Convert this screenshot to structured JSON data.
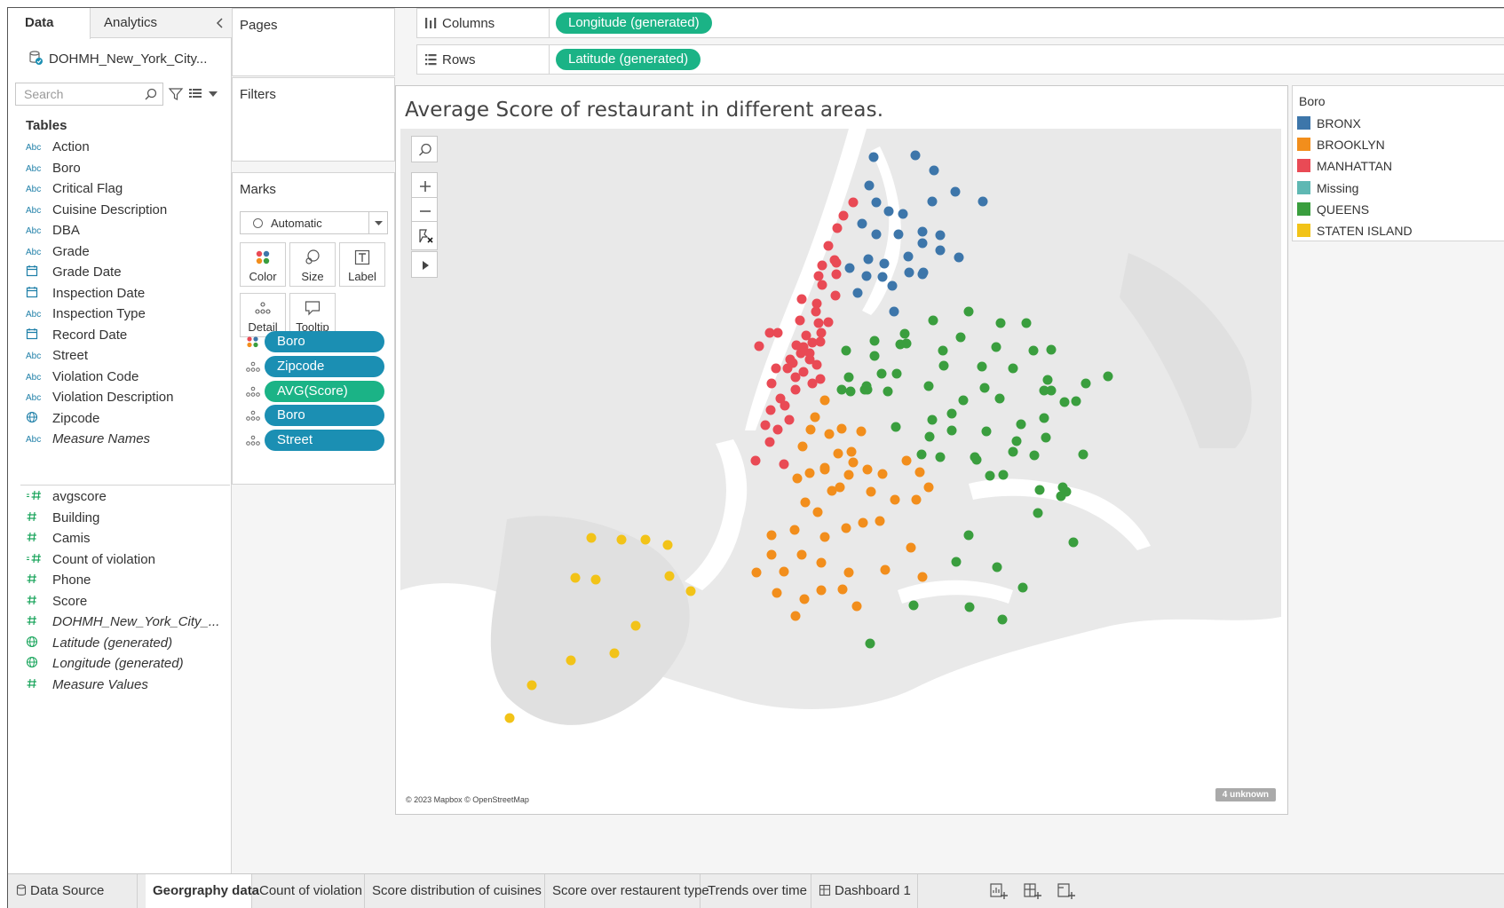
{
  "data_pane": {
    "tabs": {
      "data": "Data",
      "analytics": "Analytics"
    },
    "data_source": "DOHMH_New_York_City...",
    "search": {
      "placeholder": "Search"
    },
    "tables_title": "Tables",
    "dimensions": [
      {
        "type": "Abc",
        "name": "Action",
        "italic": false
      },
      {
        "type": "Abc",
        "name": "Boro",
        "italic": false
      },
      {
        "type": "Abc",
        "name": "Critical Flag",
        "italic": false
      },
      {
        "type": "Abc",
        "name": "Cuisine Description",
        "italic": false
      },
      {
        "type": "Abc",
        "name": "DBA",
        "italic": false
      },
      {
        "type": "Abc",
        "name": "Grade",
        "italic": false
      },
      {
        "type": "calendar",
        "name": "Grade Date",
        "italic": false
      },
      {
        "type": "calendar",
        "name": "Inspection Date",
        "italic": false
      },
      {
        "type": "Abc",
        "name": "Inspection Type",
        "italic": false
      },
      {
        "type": "calendar",
        "name": "Record Date",
        "italic": false
      },
      {
        "type": "Abc",
        "name": "Street",
        "italic": false
      },
      {
        "type": "Abc",
        "name": "Violation Code",
        "italic": false
      },
      {
        "type": "Abc",
        "name": "Violation Description",
        "italic": false
      },
      {
        "type": "globe",
        "name": "Zipcode",
        "italic": false
      },
      {
        "type": "Abc",
        "name": "Measure Names",
        "italic": true
      }
    ],
    "measures": [
      {
        "type": "calc-hash",
        "name": "avgscore",
        "italic": false
      },
      {
        "type": "hash",
        "name": "Building",
        "italic": false
      },
      {
        "type": "hash",
        "name": "Camis",
        "italic": false
      },
      {
        "type": "calc-hash",
        "name": "Count of violation",
        "italic": false
      },
      {
        "type": "hash",
        "name": "Phone",
        "italic": false
      },
      {
        "type": "hash",
        "name": "Score",
        "italic": false
      },
      {
        "type": "hash",
        "name": "DOHMH_New_York_City_...",
        "italic": true
      },
      {
        "type": "globe",
        "name": "Latitude (generated)",
        "italic": true
      },
      {
        "type": "globe",
        "name": "Longitude (generated)",
        "italic": true
      },
      {
        "type": "hash",
        "name": "Measure Values",
        "italic": true
      }
    ]
  },
  "shelves": {
    "pages": "Pages",
    "filters": "Filters",
    "columns_label": "Columns",
    "columns_pill": "Longitude (generated)",
    "rows_label": "Rows",
    "rows_pill": "Latitude (generated)"
  },
  "marks": {
    "title": "Marks",
    "mark_type": "Automatic",
    "buttons": {
      "color": "Color",
      "size": "Size",
      "label": "Label",
      "detail": "Detail",
      "tooltip": "Tooltip"
    },
    "pills": [
      {
        "icon": "color",
        "label": "Boro",
        "color": "#1b8fb3"
      },
      {
        "icon": "detail",
        "label": "Zipcode",
        "color": "#1b8fb3"
      },
      {
        "icon": "detail",
        "label": "AVG(Score)",
        "color": "#1bb386"
      },
      {
        "icon": "detail",
        "label": "Boro",
        "color": "#1b8fb3"
      },
      {
        "icon": "detail",
        "label": "Street",
        "color": "#1b8fb3"
      }
    ]
  },
  "viz": {
    "title": "Average Score of restaurant in different areas.",
    "attribution": "© 2023 Mapbox © OpenStreetMap",
    "unknown": "4 unknown"
  },
  "legend": {
    "title": "Boro",
    "items": [
      {
        "label": "BRONX",
        "color": "#3d76aa"
      },
      {
        "label": "BROOKLYN",
        "color": "#f28e1c"
      },
      {
        "label": "MANHATTAN",
        "color": "#e94a55"
      },
      {
        "label": "Missing",
        "color": "#5fb8b3"
      },
      {
        "label": "QUEENS",
        "color": "#3a9e3e"
      },
      {
        "label": "STATEN ISLAND",
        "color": "#f2c318"
      }
    ]
  },
  "tabs": {
    "data_source": "Data Source",
    "sheets": [
      "Georgraphy data",
      "Count of violation",
      "Score distribution of cuisines",
      "Score over restaurent type",
      "Trends over time",
      "Dashboard 1"
    ],
    "active_index": 0
  }
}
